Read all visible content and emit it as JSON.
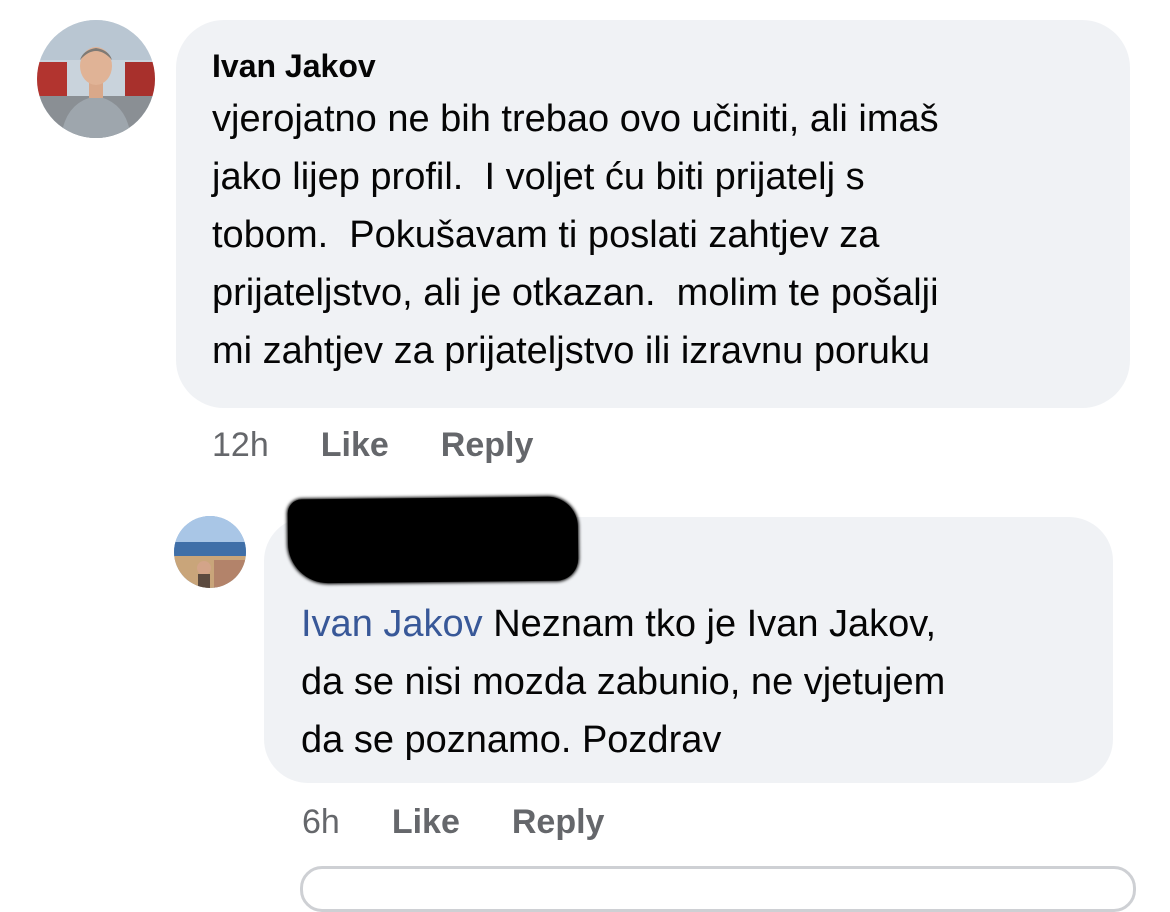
{
  "comment": {
    "author": "Ivan Jakov",
    "text": "vjerojatno ne bih trebao ovo učiniti, ali imaš\njako lijep profil.  I voljet ću biti prijatelj s\ntobom.  Pokušavam ti poslati zahtjev za\nprijateljstvo, ali je otkazan.  molim te pošalji\nmi zahtjev za prijateljstvo ili izravnu poruku",
    "time": "12h",
    "like_label": "Like",
    "reply_label": "Reply"
  },
  "reply": {
    "mention": "Ivan Jakov",
    "text": " Neznam tko je Ivan Jakov,\nda se nisi mozda zabunio, ne vjetujem\nda se poznamo. Pozdrav",
    "time": "6h",
    "like_label": "Like",
    "reply_label": "Reply"
  },
  "colors": {
    "bubble": "#f0f2f5",
    "mention": "#385898",
    "meta": "#65676b"
  }
}
